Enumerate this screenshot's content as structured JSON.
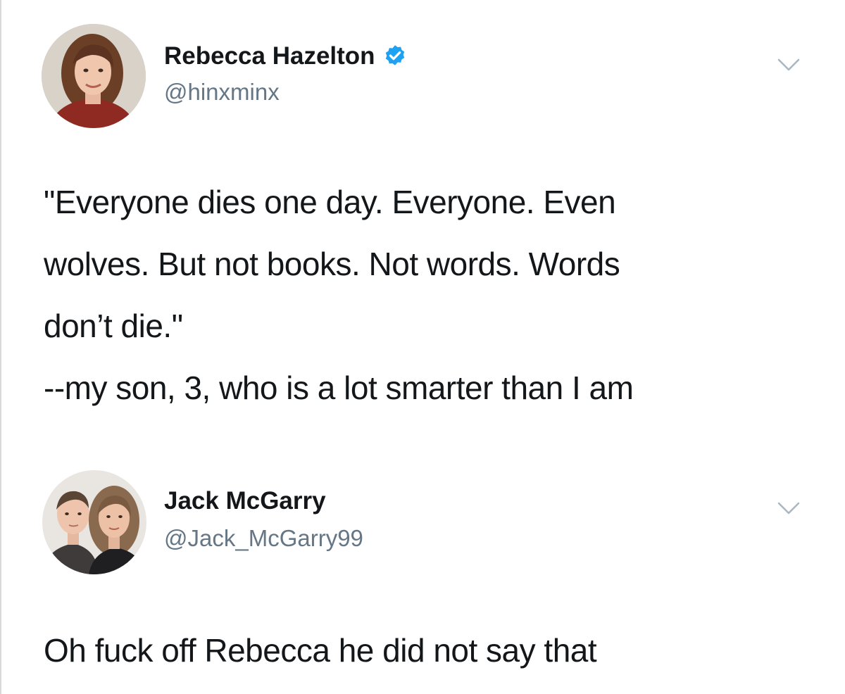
{
  "tweets": [
    {
      "display_name": "Rebecca Hazelton",
      "handle": "@hinxminx",
      "verified": true,
      "avatar_icon": "profile-photo-woman",
      "menu_icon": "chevron-down-icon",
      "lines": [
        "\"Everyone dies one day. Everyone. Even",
        "wolves. But not books. Not words. Words",
        "don’t die.\"",
        "--my son, 3, who is a lot smarter than I am"
      ]
    },
    {
      "display_name": "Jack McGarry",
      "handle": "@Jack_McGarry99",
      "verified": false,
      "avatar_icon": "profile-photo-couple",
      "menu_icon": "chevron-down-icon",
      "lines": [
        "Oh fuck off Rebecca he did not say that"
      ]
    }
  ],
  "colors": {
    "text": "#14171a",
    "secondary": "#657786",
    "verified_blue": "#1da1f2",
    "caret": "#aab8c2"
  }
}
